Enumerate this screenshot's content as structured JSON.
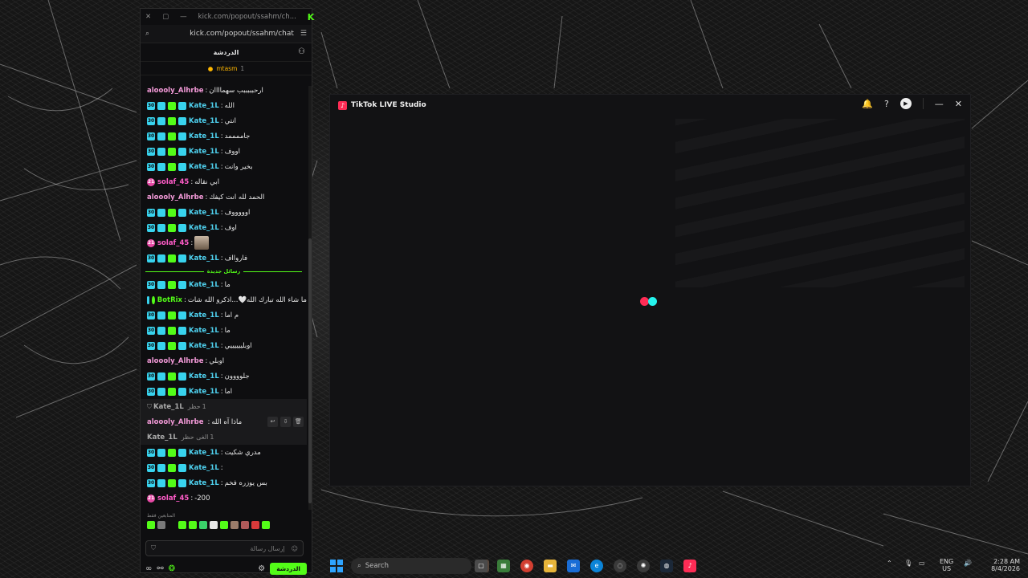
{
  "chat_window": {
    "url_title": "kick.com/popout/ssahm/ch...",
    "url": "kick.com/popout/ssahm/chat",
    "header_title": "الدردشة",
    "pinned": {
      "user": "mtasm",
      "count": "1"
    },
    "new_messages_label": "رسائل جديدة",
    "messages": [
      {
        "user": "aloooly_Alhrbe",
        "text": "ارحبببببب سهماااان",
        "type": "aloo"
      },
      {
        "user": "Kate_1L",
        "text": "الله",
        "type": "kate"
      },
      {
        "user": "Kate_1L",
        "text": "انتي",
        "type": "kate"
      },
      {
        "user": "Kate_1L",
        "text": "جاممممد",
        "type": "kate"
      },
      {
        "user": "Kate_1L",
        "text": "اووف",
        "type": "kate"
      },
      {
        "user": "Kate_1L",
        "text": "بخير وانت",
        "type": "kate"
      },
      {
        "user": "solaf_45",
        "text": "ابي نقاله",
        "type": "sol"
      },
      {
        "user": "aloooly_Alhrbe",
        "text": "الحمد لله انت كيفك",
        "type": "aloo"
      },
      {
        "user": "Kate_1L",
        "text": "اوووووف",
        "type": "kate"
      },
      {
        "user": "Kate_1L",
        "text": "اوف",
        "type": "kate"
      },
      {
        "user": "solaf_45",
        "text": "",
        "type": "sol-img"
      },
      {
        "user": "Kate_1L",
        "text": "فاروااف",
        "type": "kate"
      }
    ],
    "messages_after": [
      {
        "user": "Kate_1L",
        "text": "ما",
        "type": "kate"
      },
      {
        "user": "BotRix",
        "text": "ما شاء الله تبارك الله🤍...اذكرو الله شات",
        "type": "bot"
      },
      {
        "user": "Kate_1L",
        "text": "م اما",
        "type": "kate"
      },
      {
        "user": "Kate_1L",
        "text": "ما",
        "type": "kate"
      },
      {
        "user": "Kate_1L",
        "text": "اوبلييييييي",
        "type": "kate"
      },
      {
        "user": "aloooly_Alhrbe",
        "text": "اوبلي",
        "type": "aloo"
      },
      {
        "user": "Kate_1L",
        "text": "جلوووون",
        "type": "kate"
      },
      {
        "user": "Kate_1L",
        "text": "اما",
        "type": "kate"
      }
    ],
    "system_line_1": {
      "user": "Kate_1L",
      "text": "حظر",
      "count": "1"
    },
    "highlight_message": {
      "user": "aloooly_Alhrbe",
      "text": "ماذا آه الله"
    },
    "system_line_2": {
      "user": "Kate_1L",
      "text": "الغى حظر",
      "count": "1"
    },
    "messages_end": [
      {
        "user": "Kate_1L",
        "text": "مدري شكيت",
        "type": "kate"
      },
      {
        "user": "Kate_1L",
        "text": "",
        "type": "kate"
      },
      {
        "user": "Kate_1L",
        "text": "بس يوزره فخم",
        "type": "kate"
      },
      {
        "user": "solaf_45",
        "text": "-200",
        "type": "sol"
      }
    ],
    "emote_label": "المتابعين فقط",
    "input_placeholder": "إرسال رسالة",
    "send_label": "الدردشة"
  },
  "tiktok": {
    "title": "TikTok LIVE Studio"
  },
  "taskbar": {
    "search_placeholder": "Search",
    "lang_line1": "ENG",
    "lang_line2": "US",
    "time": "2:28 AM",
    "date": "8/4/2026"
  }
}
